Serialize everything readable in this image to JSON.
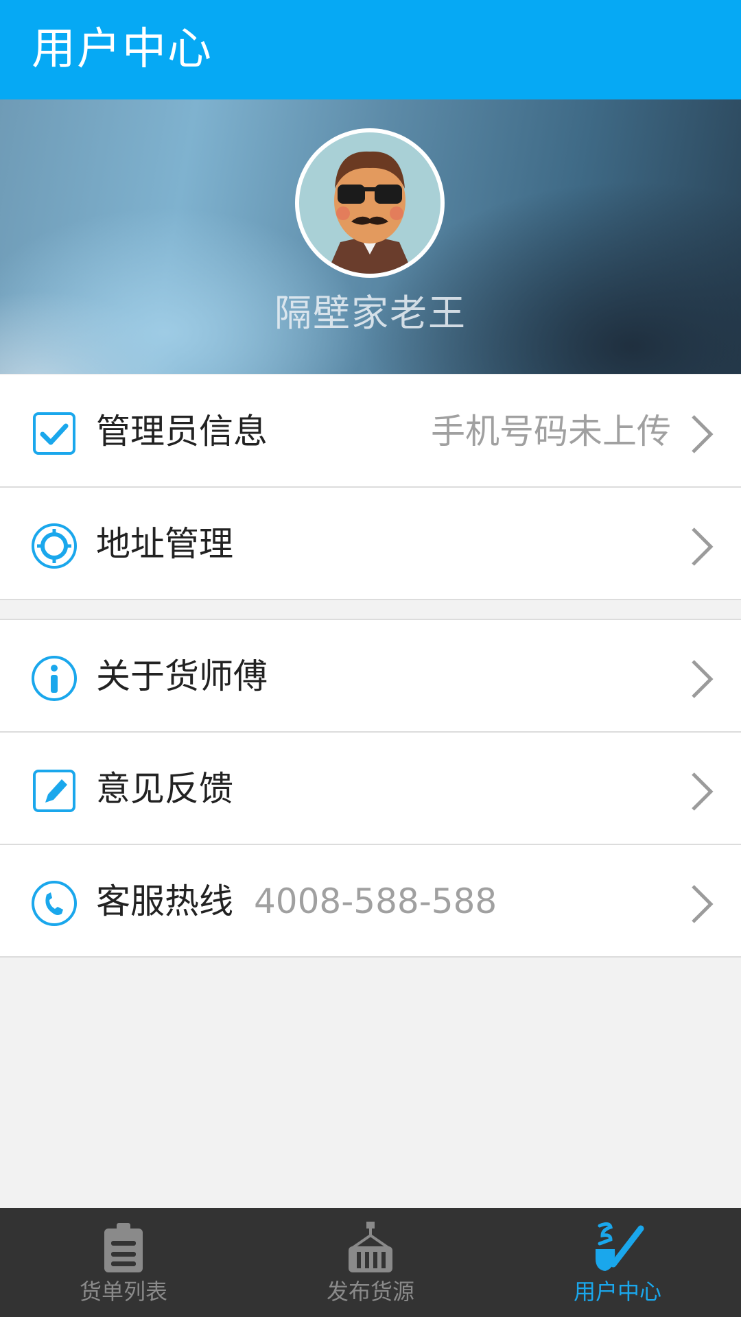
{
  "header": {
    "title": "用户中心"
  },
  "profile": {
    "username": "隔壁家老王",
    "avatar_icon": "avatar-illustration"
  },
  "menu_group_1": [
    {
      "icon": "checkbox-icon",
      "label": "管理员信息",
      "value": "手机号码未上传"
    },
    {
      "icon": "location-target-icon",
      "label": "地址管理",
      "value": ""
    }
  ],
  "menu_group_2": [
    {
      "icon": "info-icon",
      "label": "关于货师傅",
      "value": ""
    },
    {
      "icon": "edit-pen-icon",
      "label": "意见反馈",
      "value": ""
    },
    {
      "icon": "phone-icon",
      "label": "客服热线",
      "value": "4008-588-588"
    }
  ],
  "tabbar": {
    "items": [
      {
        "icon": "clipboard-icon",
        "label": "货单列表",
        "active": false
      },
      {
        "icon": "cargo-crane-icon",
        "label": "发布货源",
        "active": false
      },
      {
        "icon": "pipe-icon",
        "label": "用户中心",
        "active": true
      }
    ]
  },
  "colors": {
    "accent": "#06a9f4",
    "tabbar_bg": "#333333",
    "active_tab": "#1aa7ec",
    "muted_text": "#a0a0a0"
  }
}
